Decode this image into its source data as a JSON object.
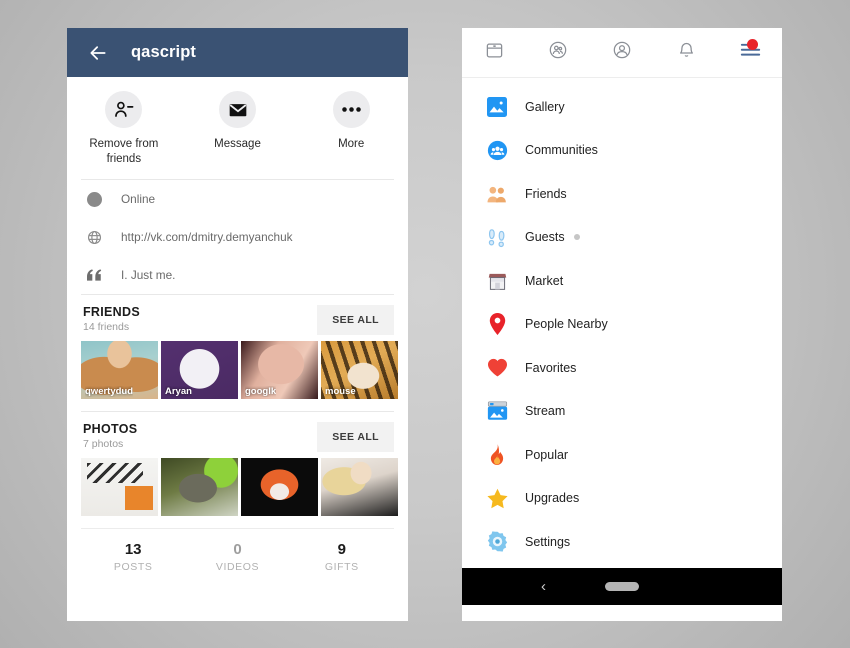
{
  "left_phone": {
    "app_bar": {
      "back_icon": "arrow-left-icon",
      "title": "qascript"
    },
    "actions": [
      {
        "icon": "person-remove-icon",
        "label": "Remove from friends"
      },
      {
        "icon": "envelope-icon",
        "label": "Message"
      },
      {
        "icon": "more-dots-icon",
        "label": "More"
      }
    ],
    "info_rows": [
      {
        "icon": "status-dot-icon",
        "text": "Online"
      },
      {
        "icon": "globe-icon",
        "text": "http://vk.com/dmitry.demyanchuk"
      },
      {
        "icon": "quote-icon",
        "text": "I. Just me."
      }
    ],
    "friends_section": {
      "title": "FRIENDS",
      "subtitle": "14 friends",
      "see_all": "SEE ALL",
      "thumbs": [
        {
          "caption": "qwertydud",
          "art": "t-blonde"
        },
        {
          "caption": "Aryan",
          "art": "t-diamond"
        },
        {
          "caption": "googlk",
          "art": "t-shh"
        },
        {
          "caption": "mouse",
          "art": "t-tiger"
        }
      ]
    },
    "photos_section": {
      "title": "PHOTOS",
      "subtitle": "7 photos",
      "see_all": "SEE ALL",
      "thumbs": [
        {
          "caption": "",
          "art": "t-screenshot"
        },
        {
          "caption": "",
          "art": "t-raccoon"
        },
        {
          "caption": "",
          "art": "t-fox"
        },
        {
          "caption": "",
          "art": "t-girl"
        }
      ]
    },
    "stats": [
      {
        "value": "13",
        "label": "POSTS",
        "muted": false
      },
      {
        "value": "0",
        "label": "VIDEOS",
        "muted": true
      },
      {
        "value": "9",
        "label": "GIFTS",
        "muted": false
      }
    ]
  },
  "right_phone": {
    "top_tabs": [
      {
        "icon": "news-feed-icon"
      },
      {
        "icon": "groups-circle-icon"
      },
      {
        "icon": "profile-circle-icon"
      },
      {
        "icon": "bell-icon"
      },
      {
        "icon": "hamburger-menu-icon",
        "badge": true
      }
    ],
    "menu_items": [
      {
        "icon": "gallery-icon",
        "label": "Gallery"
      },
      {
        "icon": "communities-icon",
        "label": "Communities"
      },
      {
        "icon": "friends-icon",
        "label": "Friends"
      },
      {
        "icon": "guests-footprints-icon",
        "label": "Guests",
        "dot": true
      },
      {
        "icon": "market-store-icon",
        "label": "Market"
      },
      {
        "icon": "people-nearby-pin-icon",
        "label": "People Nearby"
      },
      {
        "icon": "favorites-heart-icon",
        "label": "Favorites"
      },
      {
        "icon": "stream-icon",
        "label": "Stream"
      },
      {
        "icon": "popular-fire-icon",
        "label": "Popular"
      },
      {
        "icon": "upgrades-star-icon",
        "label": "Upgrades"
      },
      {
        "icon": "settings-gear-icon",
        "label": "Settings"
      }
    ],
    "nav_bar": {
      "back_icon": "nav-back-icon",
      "home_icon": "nav-home-pill-icon"
    }
  },
  "colors": {
    "app_bar": "#3a5273",
    "badge_red": "#e8232a",
    "accent_blue": "#2196f3",
    "heart_red": "#ef4136",
    "star_yellow": "#f6b91e",
    "pin_red": "#e8232a"
  }
}
